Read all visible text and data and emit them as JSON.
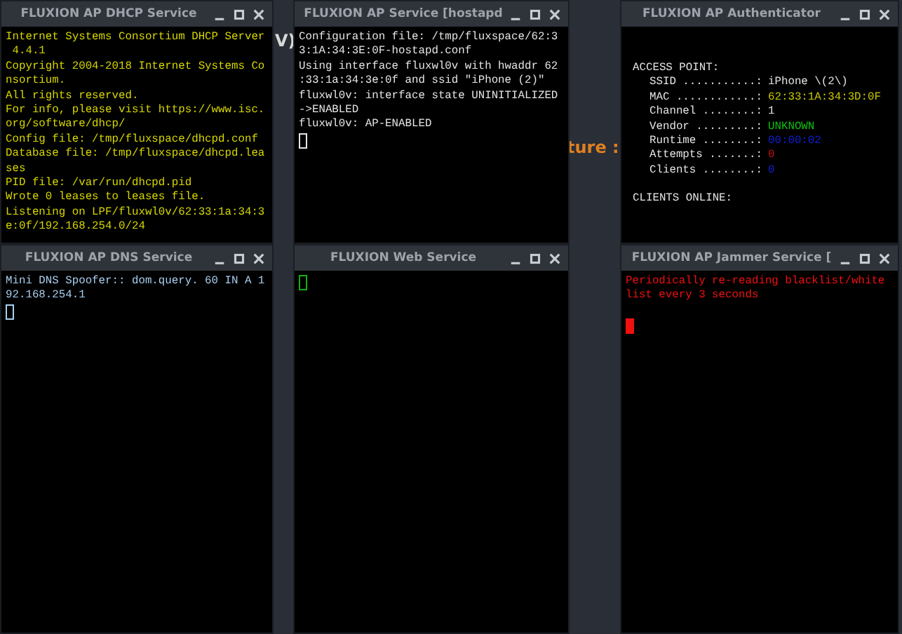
{
  "background_fragments": [
    {
      "text": "V)",
      "color": "#d8d8d8"
    },
    {
      "text": "ture :",
      "color": "#e08020"
    }
  ],
  "windows": [
    {
      "title": "FLUXION AP DHCP Service",
      "kind": "log",
      "color": "#d6d600",
      "lines": [
        "Internet Systems Consortium DHCP Server",
        " 4.4.1",
        "Copyright 2004-2018 Internet Systems Co",
        "nsortium.",
        "All rights reserved.",
        "For info, please visit https://www.isc.",
        "org/software/dhcp/",
        "Config file: /tmp/fluxspace/dhcpd.conf",
        "Database file: /tmp/fluxspace/dhcpd.lea",
        "ses",
        "PID file: /var/run/dhcpd.pid",
        "Wrote 0 leases to leases file.",
        "Listening on LPF/fluxwl0v/62:33:1a:34:3",
        "e:0f/192.168.254.0/24"
      ]
    },
    {
      "title": "FLUXION AP Service [hostapd",
      "kind": "log",
      "color": "#e4e4e4",
      "cursor_visible": true,
      "cursor_filled": false,
      "lines": [
        "Configuration file: /tmp/fluxspace/62:3",
        "3:1A:34:3E:0F-hostapd.conf",
        "Using interface fluxwl0v with hwaddr 62",
        ":33:1a:34:3e:0f and ssid \"iPhone (2)\"",
        "fluxwl0v: interface state UNINITIALIZED",
        "->ENABLED",
        "fluxwl0v: AP-ENABLED"
      ]
    },
    {
      "title": "FLUXION AP Authenticator",
      "kind": "status",
      "color": "#e4e4e4",
      "heading": "ACCESS POINT:",
      "fields": [
        {
          "label": "SSID ...........:",
          "value": "iPhone \\(2\\)",
          "color": "#e4e4e4"
        },
        {
          "label": "MAC ............:",
          "value": "62:33:1A:34:3D:0F",
          "color": "#c8c800"
        },
        {
          "label": "Channel ........:",
          "value": "1",
          "color": "#e4e4e4"
        },
        {
          "label": "Vendor .........:",
          "value": "UNKNOWN",
          "color": "#10c010"
        },
        {
          "label": "Runtime ........:",
          "value": "00:00:02",
          "color": "#1020d0"
        },
        {
          "label": "Attempts .......:",
          "value": "0",
          "color": "#c01010"
        },
        {
          "label": "Clients ........:",
          "value": "0",
          "color": "#1020d0"
        }
      ],
      "footer": "CLIENTS ONLINE:"
    },
    {
      "title": "FLUXION AP DNS Service",
      "kind": "log",
      "color": "#a8cff0",
      "cursor_visible": true,
      "cursor_filled": false,
      "lines": [
        "Mini DNS Spoofer:: dom.query. 60 IN A 1",
        "92.168.254.1"
      ]
    },
    {
      "title": "FLUXION Web Service",
      "kind": "log",
      "color": "#10b010",
      "cursor_visible": true,
      "cursor_filled": false
    },
    {
      "title": "FLUXION AP Jammer Service [",
      "kind": "log",
      "color": "#f01010",
      "cursor_visible": true,
      "cursor_filled": true,
      "lines": [
        "Periodically re-reading blacklist/white",
        "list every 3 seconds"
      ]
    }
  ]
}
